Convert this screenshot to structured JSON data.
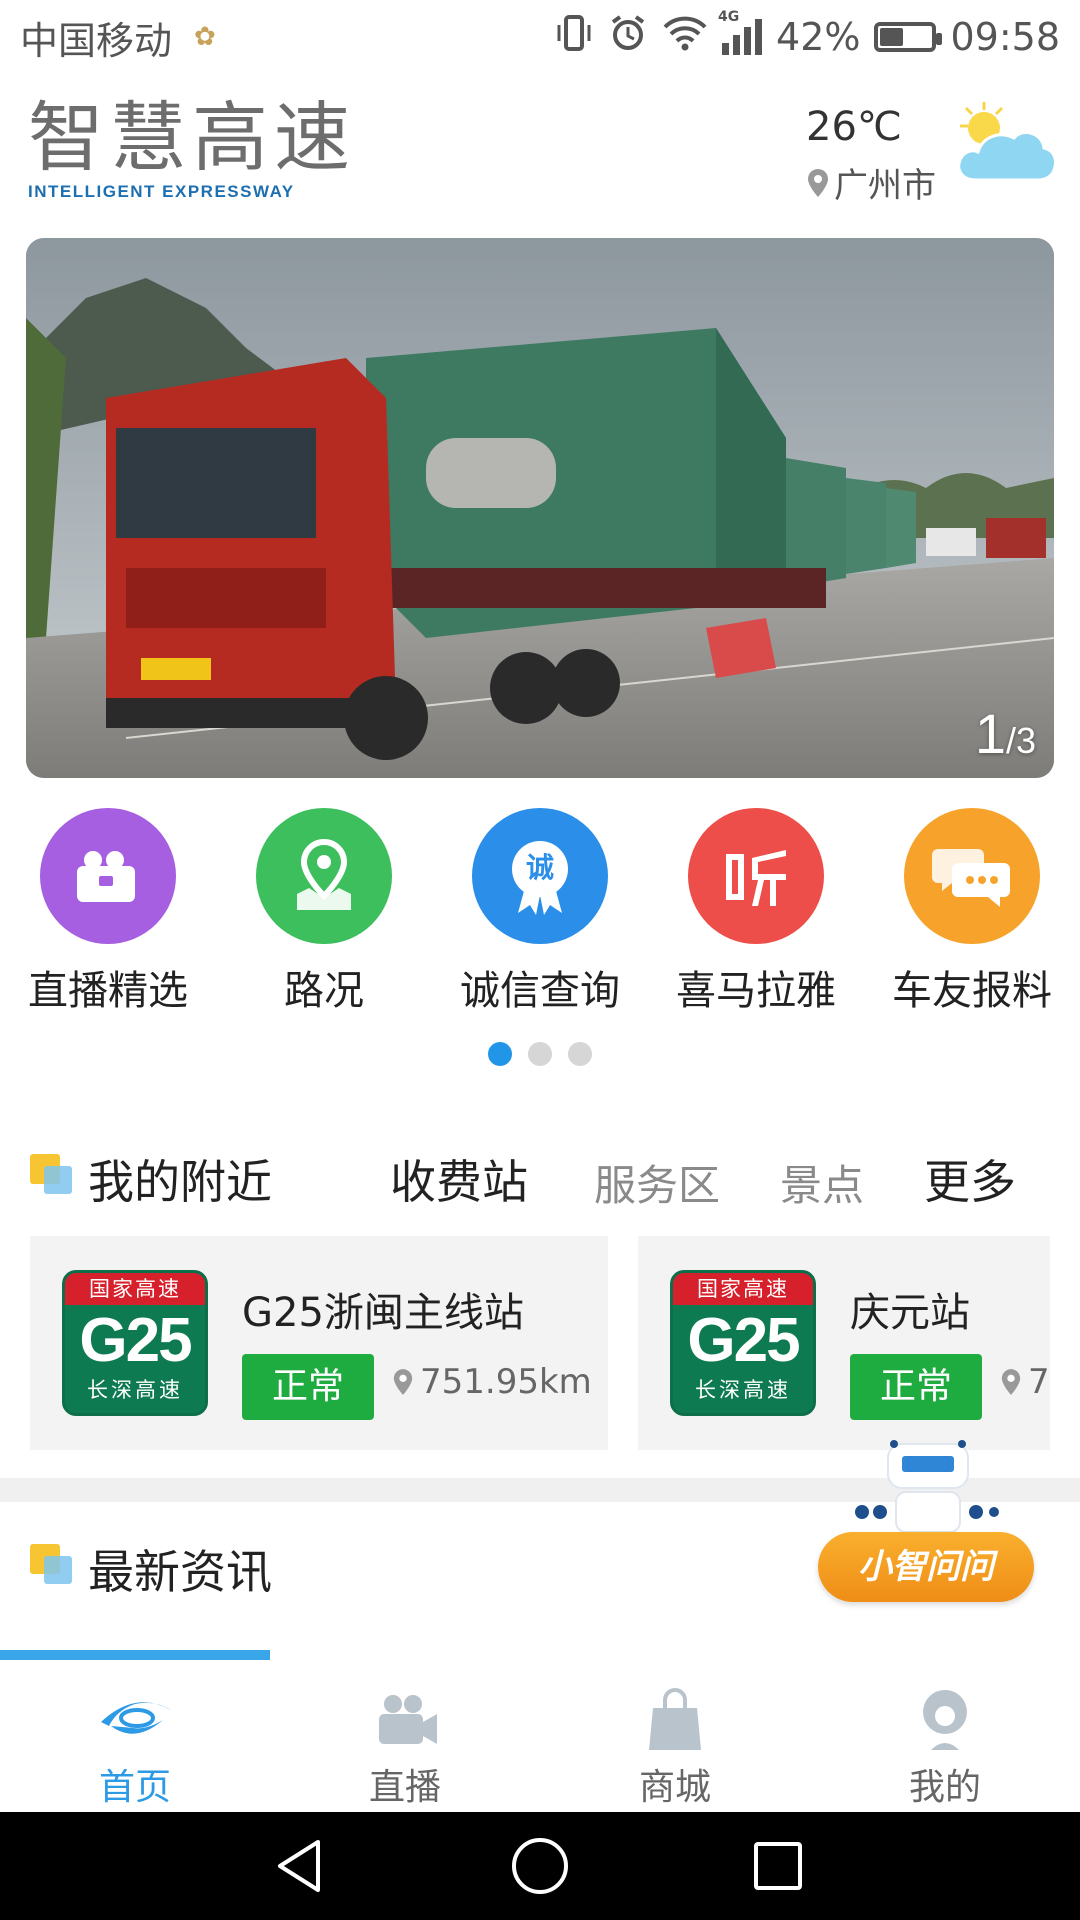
{
  "status_bar": {
    "carrier": "中国移动",
    "network_type": "4G",
    "battery_percent": "42%",
    "battery_level": 0.42,
    "time": "09:58"
  },
  "header": {
    "logo_cn": "智慧高速",
    "logo_en": "INTELLIGENT EXPRESSWAY",
    "temperature": "26℃",
    "city": "广州市",
    "weather_icon": "partly-cloudy-icon"
  },
  "banner": {
    "current": "1",
    "total": "/3"
  },
  "quick_menu": {
    "items": [
      {
        "label": "直播精选",
        "icon": "video-camera-icon",
        "color": "#a45fe0"
      },
      {
        "label": "路况",
        "icon": "map-pin-icon",
        "color": "#3cbf5c"
      },
      {
        "label": "诚信查询",
        "icon": "credit-badge-icon",
        "color": "#2b8fe9"
      },
      {
        "label": "喜马拉雅",
        "icon": "ximalaya-icon",
        "color": "#ee4e4a"
      },
      {
        "label": "车友报料",
        "icon": "chat-bubbles-icon",
        "color": "#f7a32b"
      }
    ],
    "badge_text": "诚",
    "page_count": 3,
    "active_page": 1
  },
  "nearby": {
    "title": "我的附近",
    "tabs": [
      {
        "label": "收费站",
        "active": true
      },
      {
        "label": "服务区",
        "active": false
      },
      {
        "label": "景点",
        "active": false
      }
    ],
    "more": "更多",
    "stations": [
      {
        "name": "G25浙闽主线站",
        "status": "正常",
        "distance": "751.95km",
        "shield_top": "国家高速",
        "shield_code": "G25",
        "shield_bottom": "长深高速"
      },
      {
        "name": "庆元站",
        "status": "正常",
        "distance": "7",
        "shield_top": "国家高速",
        "shield_code": "G25",
        "shield_bottom": "长深高速"
      }
    ]
  },
  "news": {
    "title": "最新资讯"
  },
  "assistant": {
    "label": "小智问问"
  },
  "bottom_nav": {
    "items": [
      {
        "label": "首页",
        "icon": "home-eye-icon",
        "active": true
      },
      {
        "label": "直播",
        "icon": "video-camera-icon",
        "active": false
      },
      {
        "label": "商城",
        "icon": "shopping-bag-icon",
        "active": false
      },
      {
        "label": "我的",
        "icon": "user-icon",
        "active": false
      }
    ],
    "active_color": "#2d9ae6",
    "inactive_color": "#b9c3cb"
  }
}
